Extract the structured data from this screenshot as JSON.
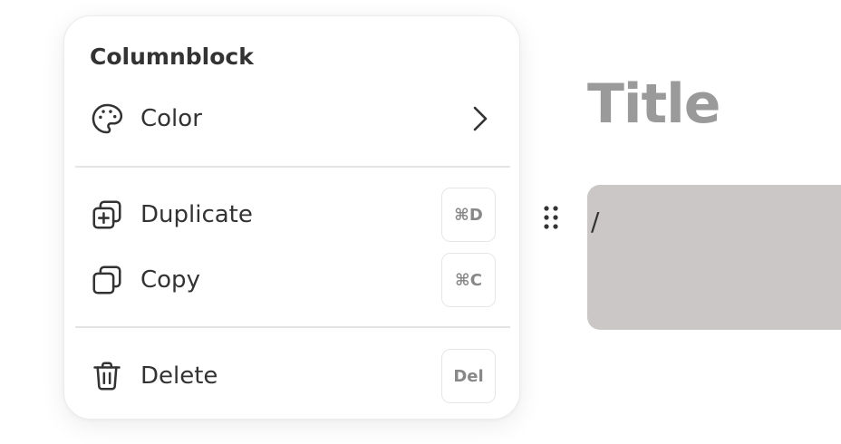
{
  "menu": {
    "header": "Columnblock",
    "items": {
      "color": {
        "label": "Color",
        "icon": "palette-icon"
      },
      "duplicate": {
        "label": "Duplicate",
        "icon": "duplicate-icon",
        "shortcut": "⌘D"
      },
      "copy": {
        "label": "Copy",
        "icon": "copy-icon",
        "shortcut": "⌘C"
      },
      "delete": {
        "label": "Delete",
        "icon": "trash-icon",
        "shortcut": "Del"
      }
    }
  },
  "editor": {
    "title": "Title",
    "block_text": "/"
  },
  "colors": {
    "block_bg": "#cbc7c7",
    "title_text": "#9a9a9a",
    "menu_text": "#333333"
  }
}
